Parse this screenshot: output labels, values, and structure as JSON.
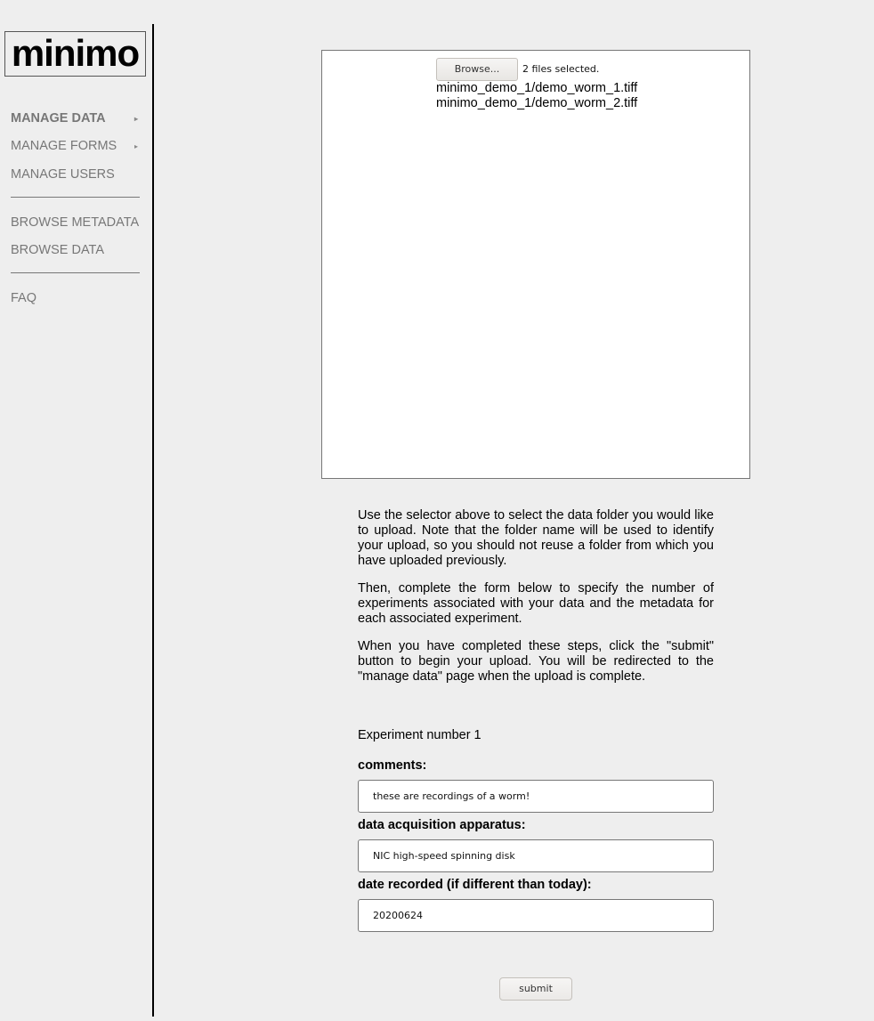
{
  "app": {
    "logo_text": "minimo"
  },
  "sidebar": {
    "items": [
      {
        "label": "MANAGE DATA",
        "has_submenu": true,
        "active": true
      },
      {
        "label": "MANAGE FORMS",
        "has_submenu": true,
        "active": false
      },
      {
        "label": "MANAGE USERS",
        "has_submenu": false,
        "active": false
      },
      {
        "label": "BROWSE METADATA",
        "has_submenu": false,
        "active": false
      },
      {
        "label": "BROWSE DATA",
        "has_submenu": false,
        "active": false
      },
      {
        "label": "FAQ",
        "has_submenu": false,
        "active": false
      }
    ],
    "submenu_arrow": "▸"
  },
  "upload": {
    "browse_label": "Browse...",
    "files_selected": "2 files selected.",
    "files": [
      "minimo_demo_1/demo_worm_1.tiff",
      "minimo_demo_1/demo_worm_2.tiff"
    ]
  },
  "instructions": [
    "Use the selector above to select the data folder you would like to upload. Note that the folder name will be used to identify your upload, so you should not reuse a folder from which you have uploaded previously.",
    "Then, complete the form below to specify the number of experiments associated with your data and the metadata for each associated experiment.",
    "When you have completed these steps, click the \"submit\" button to begin your upload. You will be redirected to the \"manage data\" page when the upload is complete."
  ],
  "form": {
    "experiment_title": "Experiment number 1",
    "fields": [
      {
        "label": "comments:",
        "value": "these are recordings of a worm!"
      },
      {
        "label": "data acquisition apparatus:",
        "value": "NIC high-speed spinning disk"
      },
      {
        "label": "date recorded (if different than today):",
        "value": "20200624"
      }
    ],
    "submit_label": "submit"
  }
}
